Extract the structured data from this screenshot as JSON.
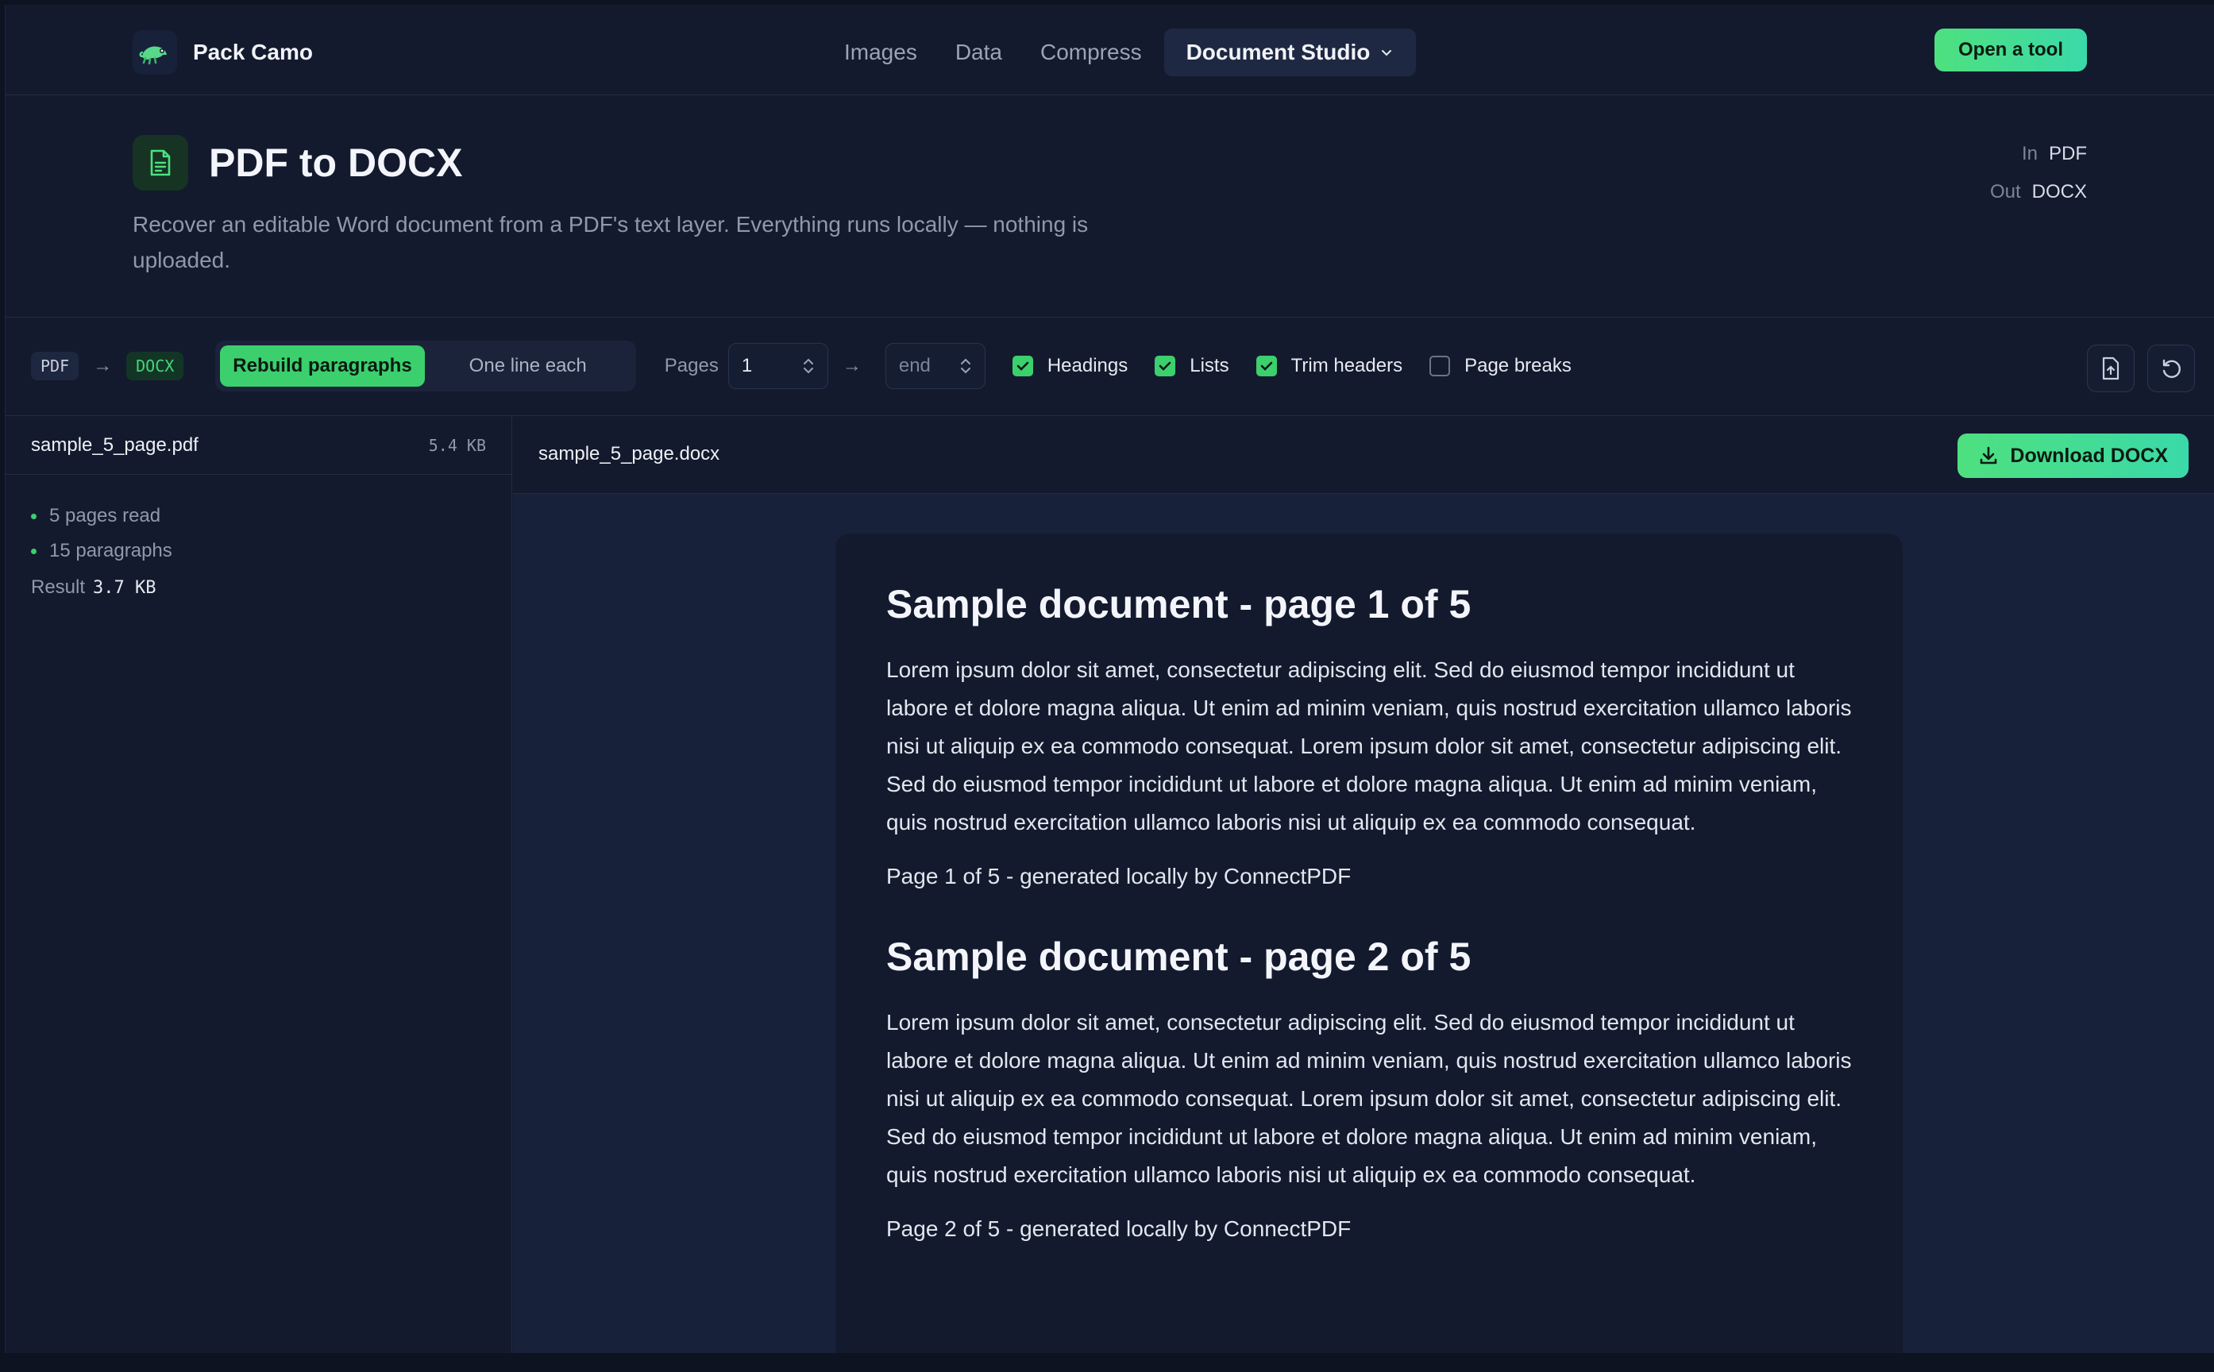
{
  "brand": {
    "name": "Pack Camo"
  },
  "nav": {
    "links": [
      "Images",
      "Data",
      "Compress"
    ],
    "active": "Document Studio",
    "cta": "Open a tool"
  },
  "header": {
    "title": "PDF to DOCX",
    "description": "Recover an editable Word document from a PDF's text layer. Everything runs locally — nothing is uploaded.",
    "in_label": "In",
    "in_value": "PDF",
    "out_label": "Out",
    "out_value": "DOCX"
  },
  "toolbar": {
    "from_chip": "PDF",
    "to_chip": "DOCX",
    "mode_on": "Rebuild paragraphs",
    "mode_off": "One line each",
    "pages_label": "Pages",
    "page_start": "1",
    "page_end_placeholder": "end",
    "options": [
      {
        "label": "Headings",
        "checked": true
      },
      {
        "label": "Lists",
        "checked": true
      },
      {
        "label": "Trim headers",
        "checked": true
      },
      {
        "label": "Page breaks",
        "checked": false
      }
    ]
  },
  "sidebar": {
    "file_name": "sample_5_page.pdf",
    "file_size": "5.4 KB",
    "stats": [
      "5 pages read",
      "15 paragraphs"
    ],
    "result_label": "Result",
    "result_value": "3.7 KB"
  },
  "main": {
    "file_name": "sample_5_page.docx",
    "download_label": "Download DOCX",
    "sections": [
      {
        "heading": "Sample document - page 1 of 5",
        "body": "Lorem ipsum dolor sit amet, consectetur adipiscing elit. Sed do eiusmod tempor incididunt ut labore et dolore magna aliqua. Ut enim ad minim veniam, quis nostrud exercitation ullamco laboris nisi ut aliquip ex ea commodo consequat. Lorem ipsum dolor sit amet, consectetur adipiscing elit. Sed do eiusmod tempor incididunt ut labore et dolore magna aliqua. Ut enim ad minim veniam, quis nostrud exercitation ullamco laboris nisi ut aliquip ex ea commodo consequat.",
        "footer": "Page 1 of 5 - generated locally by ConnectPDF"
      },
      {
        "heading": "Sample document - page 2 of 5",
        "body": "Lorem ipsum dolor sit amet, consectetur adipiscing elit. Sed do eiusmod tempor incididunt ut labore et dolore magna aliqua. Ut enim ad minim veniam, quis nostrud exercitation ullamco laboris nisi ut aliquip ex ea commodo consequat. Lorem ipsum dolor sit amet, consectetur adipiscing elit. Sed do eiusmod tempor incididunt ut labore et dolore magna aliqua. Ut enim ad minim veniam, quis nostrud exercitation ullamco laboris nisi ut aliquip ex ea commodo consequat.",
        "footer": "Page 2 of 5 - generated locally by ConnectPDF"
      }
    ]
  },
  "colors": {
    "accent": "#3ccf6e",
    "background": "#131a2e",
    "panel": "#18213a"
  }
}
